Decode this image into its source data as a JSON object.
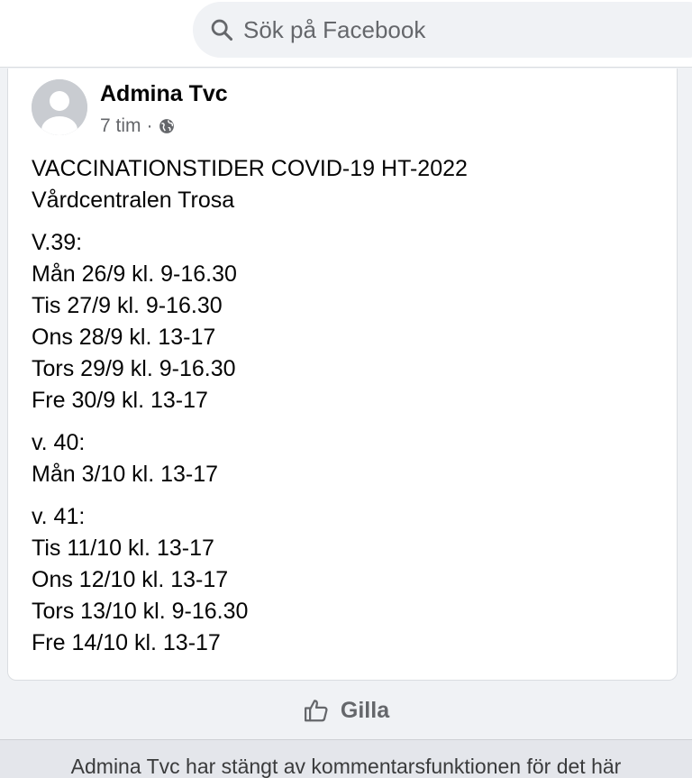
{
  "search": {
    "placeholder": "Sök på Facebook",
    "icon": "search-icon"
  },
  "post": {
    "author": "Admina Tvc",
    "time": "7 tim",
    "separator": "·",
    "privacy_icon": "globe-icon",
    "paragraphs": [
      [
        "VACCINATIONSTIDER COVID-19 HT-2022",
        "Vårdcentralen Trosa"
      ],
      [
        "V.39:",
        "Mån 26/9 kl. 9-16.30",
        "Tis 27/9 kl. 9-16.30",
        "Ons 28/9 kl. 13-17",
        "Tors 29/9 kl. 9-16.30",
        "Fre 30/9 kl. 13-17"
      ],
      [
        "v. 40:",
        "Mån 3/10 kl. 13-17"
      ],
      [
        "v. 41:",
        "Tis 11/10 kl. 13-17",
        "Ons 12/10 kl. 13-17",
        "Tors 13/10 kl. 9-16.30",
        "Fre 14/10 kl. 13-17"
      ]
    ]
  },
  "actions": {
    "like_label": "Gilla",
    "like_icon": "thumbs-up-icon"
  },
  "notice": {
    "text": "Admina Tvc har stängt av kommentarsfunktionen för det här"
  },
  "colors": {
    "secondary_text": "#65676b",
    "search_bg": "#f0f2f5",
    "page_bg": "#f0f2f5"
  }
}
